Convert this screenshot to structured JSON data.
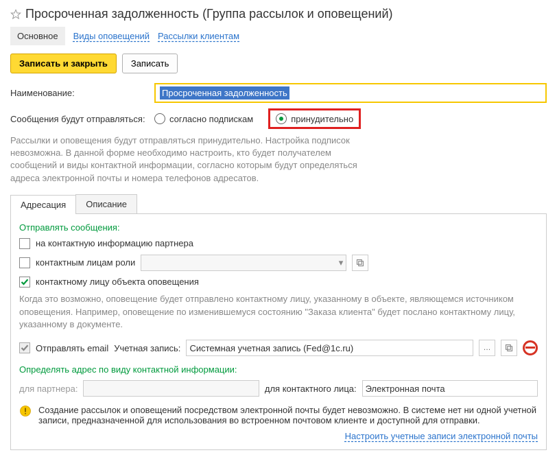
{
  "header": {
    "title": "Просроченная задолженность (Группа рассылок и оповещений)"
  },
  "topTabs": {
    "main": "Основное",
    "types": "Виды оповещений",
    "mailings": "Рассылки клиентам"
  },
  "toolbar": {
    "saveClose": "Записать и закрыть",
    "save": "Записать"
  },
  "form": {
    "nameLabel": "Наименование:",
    "nameValue": "Просроченная задолженность",
    "sendLabel": "Сообщения будут отправляться:",
    "optionA": "согласно подпискам",
    "optionB": "принудительно"
  },
  "description": "Рассылки и оповещения будут отправляться принудительно. Настройка подписок невозможна. В данной форме необходимо настроить, кто будет получателем сообщений и виды контактной информации, согласно которым будут определяться адреса электронной почты и номера телефонов адресатов.",
  "innerTabs": {
    "addressing": "Адресация",
    "descriptionTab": "Описание"
  },
  "section": {
    "title": "Отправлять сообщения:",
    "chkPartner": "на контактную информацию партнера",
    "chkRole": "контактным лицам роли",
    "chkObject": "контактному лицу объекта оповещения",
    "info": "Когда это возможно, оповещение будет отправлено контактному лицу, указанному в объекте, являющемся источником оповещения. Например, оповещение по изменившемуся состоянию \"Заказа клиента\" будет послано контактному лицу, указанному в документе.",
    "emailLabel": "Отправлять email",
    "accountLabel": "Учетная запись:",
    "accountValue": "Системная учетная запись (Fed@1c.ru)",
    "addrTitle": "Определять адрес по виду контактной информации:",
    "forPartner": "для партнера:",
    "forContact": "для контактного лица:",
    "emailValue": "Электронная почта",
    "warning": "Создание рассылок и оповещений посредством электронной почты будет невозможно. В системе нет ни одной учетной записи, предназначенной для использования во встроенном почтовом клиенте и доступной для отправки.",
    "footerLink": "Настроить учетные записи электронной почты"
  }
}
